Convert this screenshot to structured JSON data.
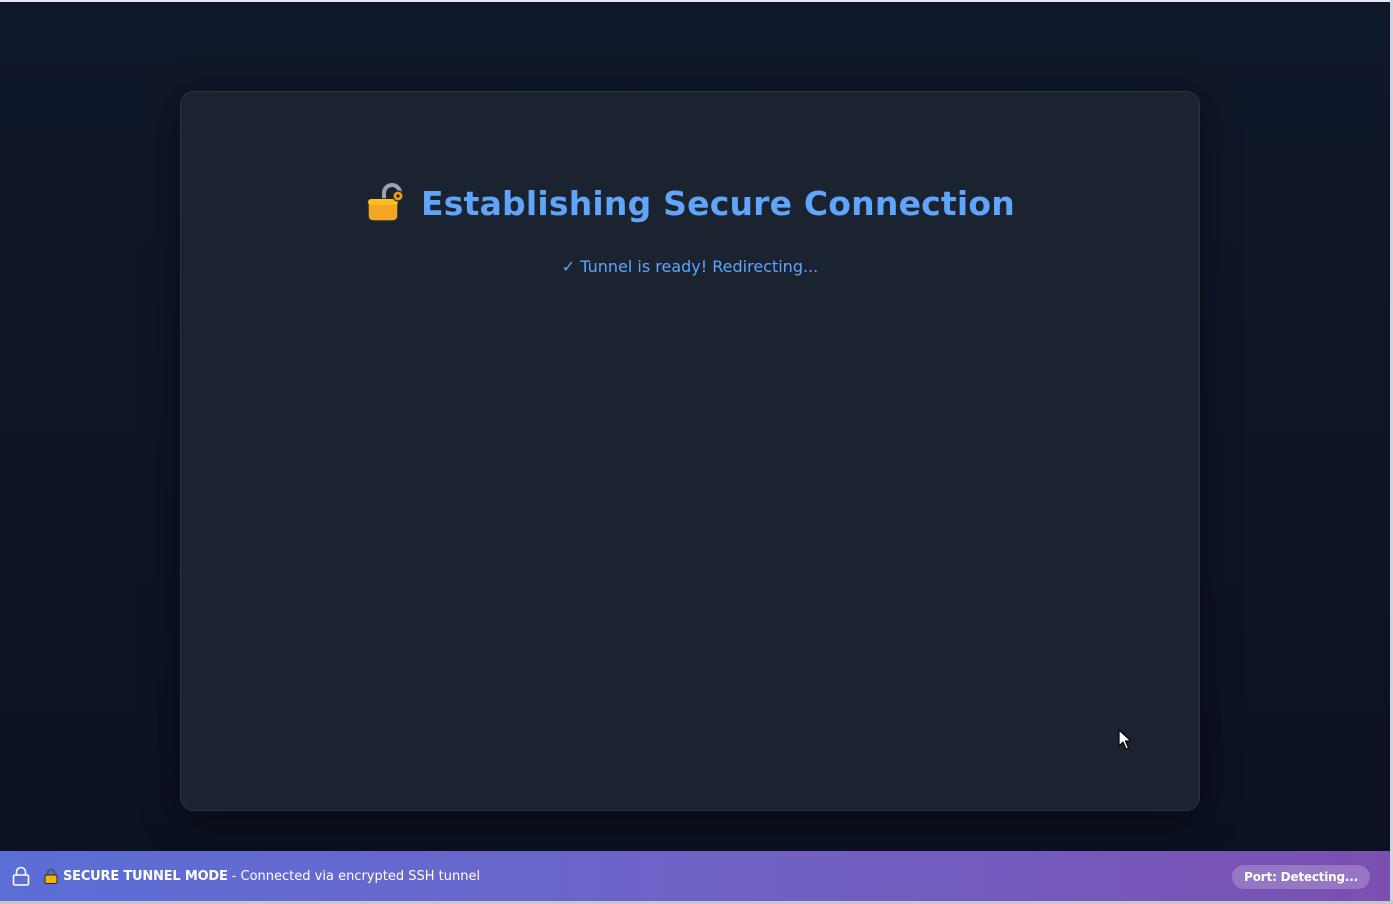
{
  "card": {
    "title": "Establishing Secure Connection",
    "status": "✓ Tunnel is ready! Redirecting..."
  },
  "banner": {
    "mode_label": "SECURE TUNNEL MODE",
    "description": "- Connected via encrypted SSH tunnel",
    "port_badge": "Port: Detecting..."
  },
  "icons": {
    "title_icon": "unlocked-padlock-icon",
    "banner_icon": "padlock-outline-icon",
    "banner_small_icon": "locked-padlock-icon",
    "cursor": "mouse-cursor"
  },
  "colors": {
    "background": "#0f172a",
    "card": "#1b2331",
    "accent": "#60a5fa",
    "banner_start": "#5b6fd6",
    "banner_end": "#7a4fb0"
  }
}
